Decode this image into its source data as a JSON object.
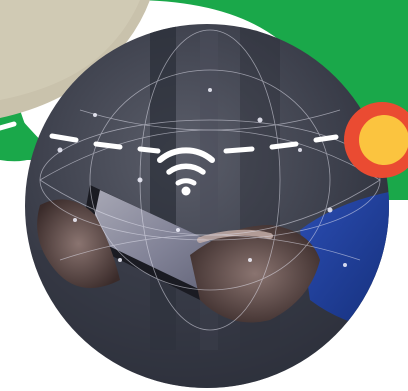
{
  "illustration": {
    "subject": "wifi-phone-network-icon",
    "colors": {
      "green_band": "#1aa84a",
      "beige_shape": "#c9c2ac",
      "dashed_line": "#ffffff",
      "badge_outer": "#ea4b32",
      "badge_inner": "#fbc43f",
      "photo_dark": "#2a2f3c",
      "photo_blue": "#1b3a8f",
      "wifi_glyph": "#ffffff"
    }
  }
}
